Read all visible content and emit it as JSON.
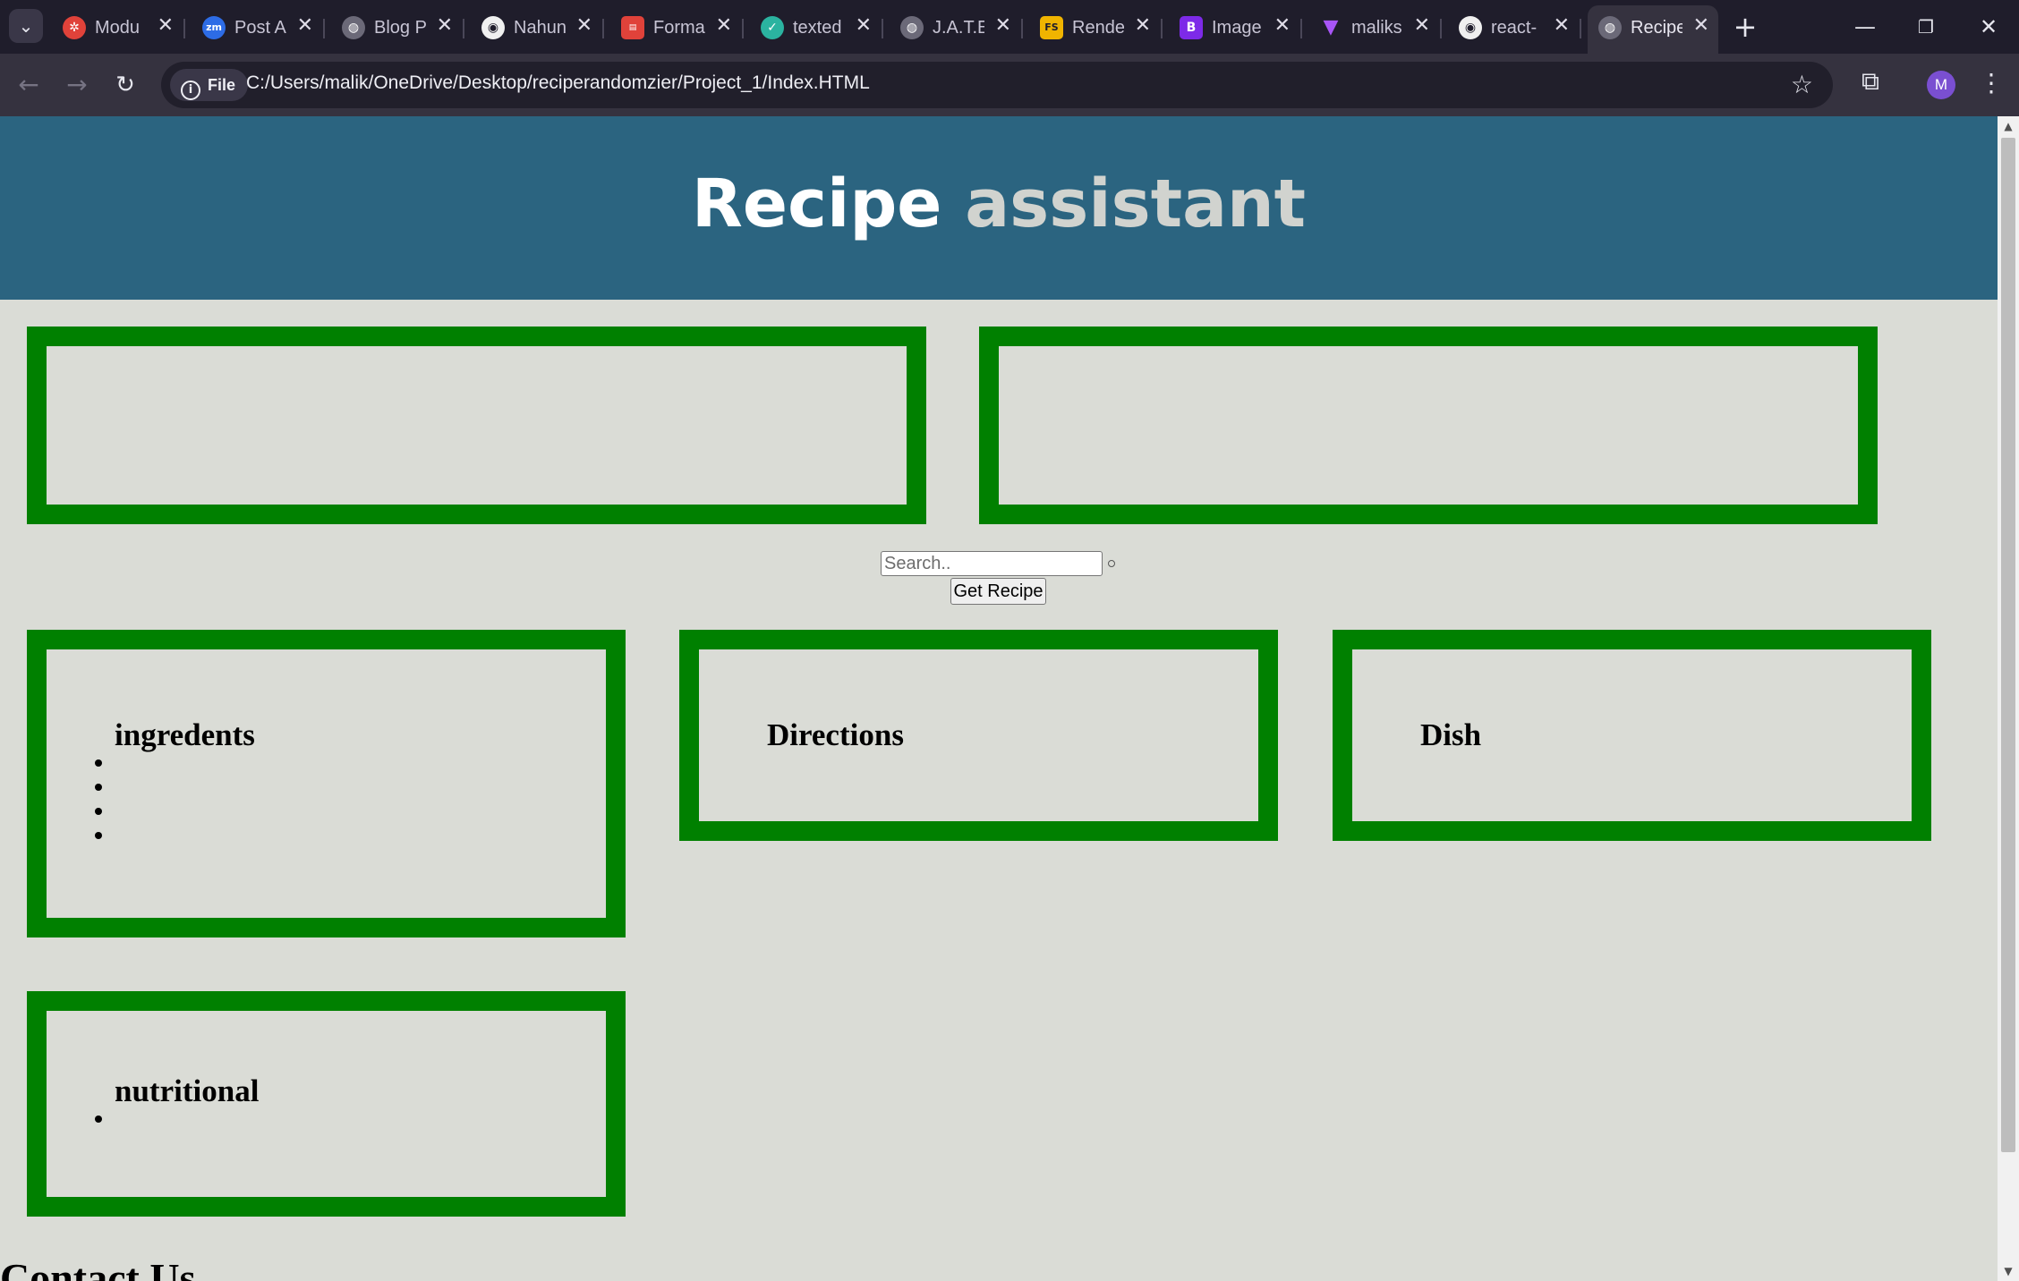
{
  "browser": {
    "tabs": [
      {
        "label": "Modu",
        "icon": "wheel-icon",
        "color": "#e0423a"
      },
      {
        "label": "Post A",
        "icon": "zm-icon",
        "color": "#2d6ce6"
      },
      {
        "label": "Blog P",
        "icon": "globe-icon",
        "color": "#9a98a6"
      },
      {
        "label": "Nahun",
        "icon": "github-icon",
        "color": "#ffffff"
      },
      {
        "label": "Forma",
        "icon": "docs-icon",
        "color": "#e0423a"
      },
      {
        "label": "texted",
        "icon": "leaf-icon",
        "color": "#2bb3a0"
      },
      {
        "label": "J.A.T.E",
        "icon": "globe-icon",
        "color": "#9a98a6"
      },
      {
        "label": "Rende",
        "icon": "fs-icon",
        "color": "#f0b400"
      },
      {
        "label": "Image",
        "icon": "b-icon",
        "color": "#7d2ae8"
      },
      {
        "label": "maliks",
        "icon": "vite-icon",
        "color": "#a855f7"
      },
      {
        "label": "react-",
        "icon": "github-icon",
        "color": "#ffffff"
      },
      {
        "label": "Recipe",
        "icon": "globe-icon",
        "color": "#9a98a6",
        "active": true
      }
    ],
    "address": {
      "scheme_label": "File",
      "url": "C:/Users/malik/OneDrive/Desktop/reciperandomzier/Project_1/Index.HTML"
    },
    "profile_initial": "M"
  },
  "page": {
    "title_word1": "Recipe",
    "title_word2": "assistant",
    "search_placeholder": "Search..",
    "button_label": "Get Recipe",
    "boxes": {
      "ingredents_title": "ingredents",
      "ingredents_items": [
        "",
        "",
        "",
        ""
      ],
      "directions_title": "Directions",
      "dish_title": "Dish",
      "nutritional_title": "nutritional",
      "nutritional_items": [
        ""
      ]
    },
    "contact_heading": "Contact Us"
  },
  "colors": {
    "header_bg": "#2b6480",
    "box_border": "#008000",
    "page_bg": "#dadcd6"
  }
}
